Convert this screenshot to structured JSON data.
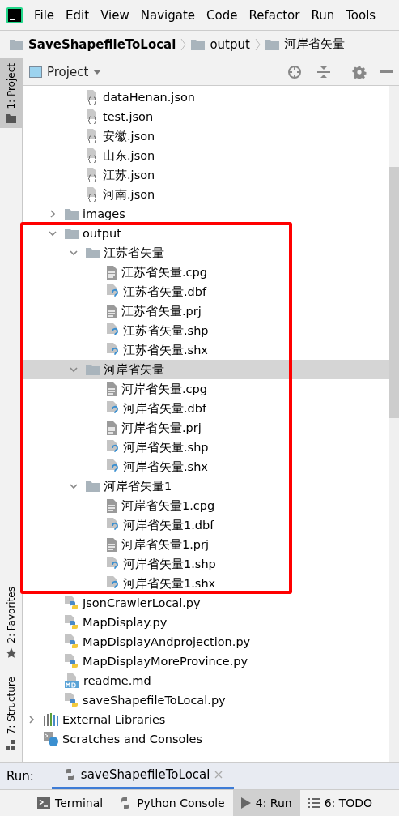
{
  "menu": [
    "File",
    "Edit",
    "View",
    "Navigate",
    "Code",
    "Refactor",
    "Run",
    "Tools"
  ],
  "breadcrumb": [
    "SaveShapefileToLocal",
    "output",
    "河岸省矢量"
  ],
  "side_tabs": [
    {
      "label": "1: Project",
      "kind": "folder",
      "selected": true
    },
    {
      "label": "2: Favorites",
      "kind": "star",
      "selected": false
    },
    {
      "label": "7: Structure",
      "kind": "structure",
      "selected": false
    }
  ],
  "project_panel": {
    "title": "Project"
  },
  "tree": {
    "scrolled_children": [
      {
        "label": "dataHenan.json",
        "kind": "json",
        "selected": false
      },
      {
        "label": "test.json",
        "kind": "json",
        "selected": false
      },
      {
        "label": "安徽.json",
        "kind": "json",
        "selected": false
      },
      {
        "label": "山东.json",
        "kind": "json",
        "selected": false
      },
      {
        "label": "江苏.json",
        "kind": "json",
        "selected": false
      },
      {
        "label": "河南.json",
        "kind": "json",
        "selected": false
      }
    ],
    "items": [
      {
        "label": "images",
        "kind": "folder",
        "expanded": false,
        "selected": false
      },
      {
        "label": "output",
        "kind": "folder",
        "expanded": true,
        "selected": false,
        "children": [
          {
            "label": "江苏省矢量",
            "kind": "folder",
            "expanded": true,
            "selected": false,
            "children": [
              {
                "label": "江苏省矢量.cpg",
                "kind": "text",
                "selected": false
              },
              {
                "label": "江苏省矢量.dbf",
                "kind": "unknown",
                "selected": false
              },
              {
                "label": "江苏省矢量.prj",
                "kind": "text",
                "selected": false
              },
              {
                "label": "江苏省矢量.shp",
                "kind": "unknown",
                "selected": false
              },
              {
                "label": "江苏省矢量.shx",
                "kind": "unknown",
                "selected": false
              }
            ]
          },
          {
            "label": "河岸省矢量",
            "kind": "folder",
            "expanded": true,
            "selected": true,
            "children": [
              {
                "label": "河岸省矢量.cpg",
                "kind": "text",
                "selected": false
              },
              {
                "label": "河岸省矢量.dbf",
                "kind": "unknown",
                "selected": false
              },
              {
                "label": "河岸省矢量.prj",
                "kind": "text",
                "selected": false
              },
              {
                "label": "河岸省矢量.shp",
                "kind": "unknown",
                "selected": false
              },
              {
                "label": "河岸省矢量.shx",
                "kind": "unknown",
                "selected": false
              }
            ]
          },
          {
            "label": "河岸省矢量1",
            "kind": "folder",
            "expanded": true,
            "selected": false,
            "children": [
              {
                "label": "河岸省矢量1.cpg",
                "kind": "text",
                "selected": false
              },
              {
                "label": "河岸省矢量1.dbf",
                "kind": "unknown",
                "selected": false
              },
              {
                "label": "河岸省矢量1.prj",
                "kind": "text",
                "selected": false
              },
              {
                "label": "河岸省矢量1.shp",
                "kind": "unknown",
                "selected": false
              },
              {
                "label": "河岸省矢量1.shx",
                "kind": "unknown",
                "selected": false
              }
            ]
          }
        ]
      },
      {
        "label": "JsonCrawlerLocal.py",
        "kind": "python",
        "selected": false
      },
      {
        "label": "MapDisplay.py",
        "kind": "python",
        "selected": false
      },
      {
        "label": "MapDisplayAndprojection.py",
        "kind": "python",
        "selected": false
      },
      {
        "label": "MapDisplayMoreProvince.py",
        "kind": "python",
        "selected": false
      },
      {
        "label": "readme.md",
        "kind": "markdown",
        "selected": false
      },
      {
        "label": "saveShapefileToLocal.py",
        "kind": "python",
        "selected": false
      }
    ],
    "roots": [
      {
        "label": "External Libraries",
        "kind": "library",
        "expanded": false,
        "selected": false
      },
      {
        "label": "Scratches and Consoles",
        "kind": "scratches",
        "selected": false
      }
    ]
  },
  "annotation": {
    "kind": "rectangle"
  },
  "run_bar": {
    "label": "Run:",
    "tabs": [
      {
        "label": "saveShapefileToLocal",
        "selected": true
      }
    ]
  },
  "bottom_tabs": [
    {
      "label": "Terminal",
      "kind": "terminal",
      "selected": false
    },
    {
      "label": "Python Console",
      "kind": "python",
      "selected": false
    },
    {
      "label": "4: Run",
      "kind": "run",
      "selected": true
    },
    {
      "label": "6: TODO",
      "kind": "todo",
      "selected": false
    }
  ]
}
